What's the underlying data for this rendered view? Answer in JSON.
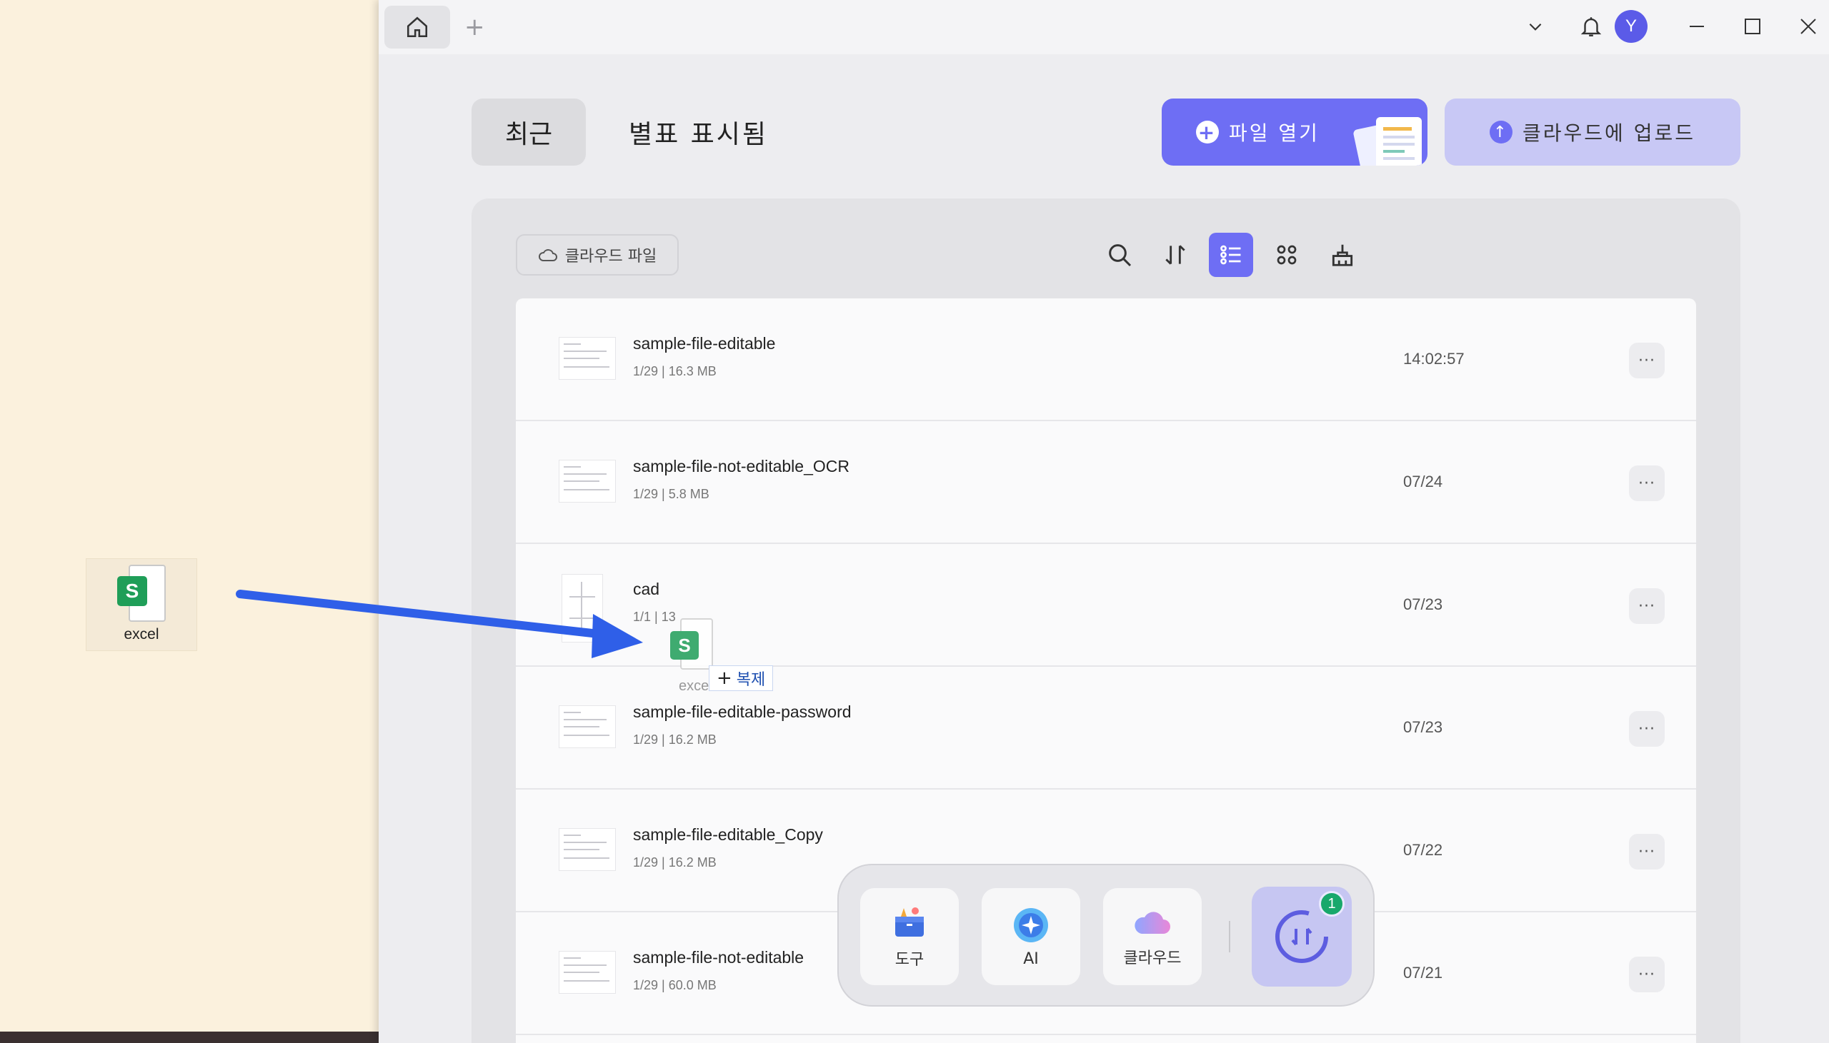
{
  "desktop": {
    "icon": {
      "label": "excel",
      "glyph": "S",
      "color": "#1f9e58"
    }
  },
  "titlebar": {
    "home_icon": "home-icon",
    "new_tab": "+",
    "avatar_initial": "Y"
  },
  "tabs": {
    "recent": "최근",
    "starred": "별표 표시됨"
  },
  "actions": {
    "open_file": "파일 열기",
    "upload_cloud": "클라우드에 업로드"
  },
  "panel": {
    "cloud_files": "클라우드 파일",
    "tools": [
      "search-icon",
      "sort-icon",
      "list-view-icon",
      "grid-view-icon",
      "clear-icon"
    ]
  },
  "files": [
    {
      "name": "sample-file-editable",
      "meta": "1/29 | 16.3 MB",
      "date": "14:02:57"
    },
    {
      "name": "sample-file-not-editable_OCR",
      "meta": "1/29 | 5.8 MB",
      "date": "07/24"
    },
    {
      "name": "cad",
      "meta": "1/1 | 13",
      "date": "07/23"
    },
    {
      "name": "sample-file-editable-password",
      "meta": "1/29 | 16.2 MB",
      "date": "07/23"
    },
    {
      "name": "sample-file-editable_Copy",
      "meta": "1/29 | 16.2 MB",
      "date": "07/22"
    },
    {
      "name": "sample-file-not-editable",
      "meta": "1/29 | 60.0 MB",
      "date": "07/21"
    }
  ],
  "more_label": "···",
  "dock": {
    "tools": "도구",
    "ai": "AI",
    "cloud": "클라우드",
    "convert_badge": "1"
  },
  "drag": {
    "ghost_label": "excel",
    "ghost_glyph": "S",
    "tooltip_plus": "+",
    "tooltip": "복제"
  },
  "colors": {
    "accent": "#6e6ef4",
    "accent_light": "#c8c8f5",
    "arrow": "#2f5fe8",
    "excel_green": "#1f9e58",
    "desktop_bg": "#fbf1dd"
  }
}
